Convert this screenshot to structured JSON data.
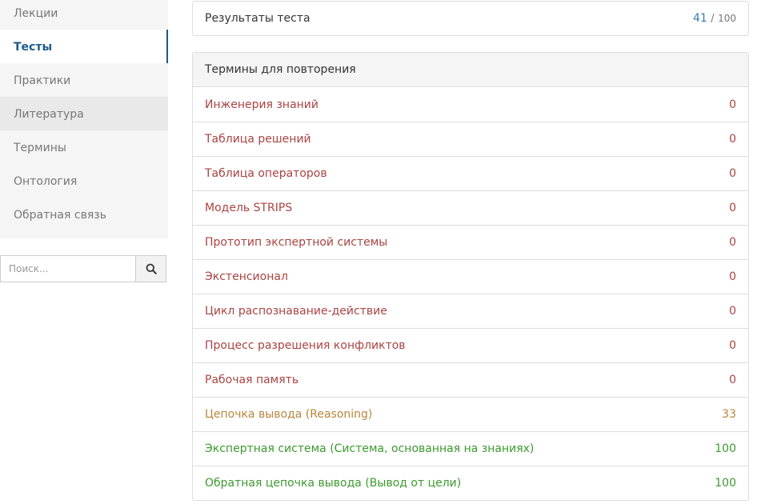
{
  "sidebar": {
    "items": [
      {
        "label": "Лекции"
      },
      {
        "label": "Тесты"
      },
      {
        "label": "Практики"
      },
      {
        "label": "Литература"
      },
      {
        "label": "Термины"
      },
      {
        "label": "Онтология"
      },
      {
        "label": "Обратная связь"
      }
    ]
  },
  "search": {
    "placeholder": "Поиск...",
    "icon": "search-icon"
  },
  "results": {
    "label": "Результаты теста",
    "score": "41",
    "separator": "/",
    "max": "100",
    "score_color": "#337ab7"
  },
  "terms": {
    "heading": "Термины для повторения",
    "colors": {
      "low": "#a94442",
      "mid": "#b8863b",
      "high": "#3c9a2e"
    },
    "items": [
      {
        "label": "Инженерия знаний",
        "value": "0",
        "level": "low"
      },
      {
        "label": "Таблица решений",
        "value": "0",
        "level": "low"
      },
      {
        "label": "Таблица операторов",
        "value": "0",
        "level": "low"
      },
      {
        "label": "Модель STRIPS",
        "value": "0",
        "level": "low"
      },
      {
        "label": "Прототип экспертной системы",
        "value": "0",
        "level": "low"
      },
      {
        "label": "Экстенсионал",
        "value": "0",
        "level": "low"
      },
      {
        "label": "Цикл распознавание-действие",
        "value": "0",
        "level": "low"
      },
      {
        "label": "Процесс разрешения конфликтов",
        "value": "0",
        "level": "low"
      },
      {
        "label": "Рабочая память",
        "value": "0",
        "level": "low"
      },
      {
        "label": "Цепочка вывода (Reasoning)",
        "value": "33",
        "level": "mid"
      },
      {
        "label": "Экспертная система (Система, основанная на знаниях)",
        "value": "100",
        "level": "high"
      },
      {
        "label": "Обратная цепочка вывода (Вывод от цели)",
        "value": "100",
        "level": "high"
      }
    ]
  }
}
